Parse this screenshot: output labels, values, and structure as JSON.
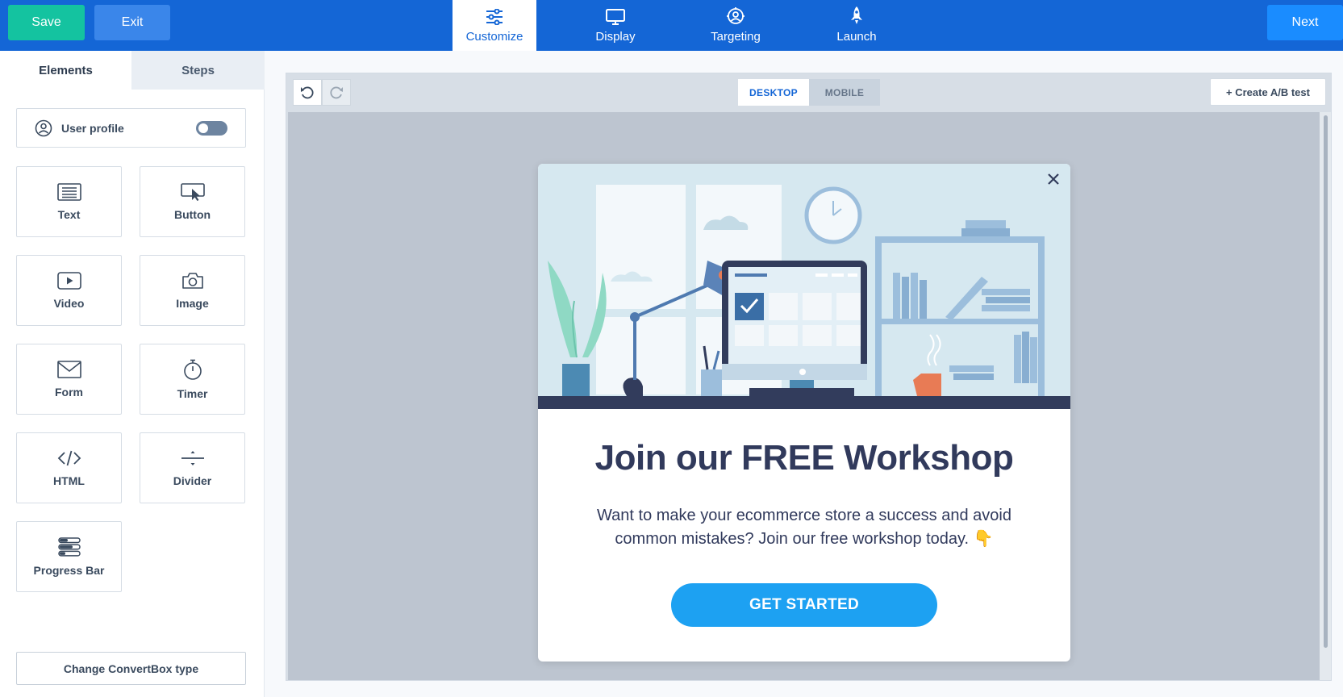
{
  "topbar": {
    "save_label": "Save",
    "exit_label": "Exit",
    "next_label": "Next",
    "tabs": [
      {
        "label": "Customize",
        "icon": "sliders-icon",
        "active": true
      },
      {
        "label": "Display",
        "icon": "monitor-icon",
        "active": false
      },
      {
        "label": "Targeting",
        "icon": "target-icon",
        "active": false
      },
      {
        "label": "Launch",
        "icon": "rocket-icon",
        "active": false
      }
    ]
  },
  "sidebar": {
    "tabs": [
      {
        "label": "Elements",
        "active": true
      },
      {
        "label": "Steps",
        "active": false
      }
    ],
    "user_profile": {
      "label": "User profile",
      "icon": "user-circle-icon",
      "enabled": false
    },
    "elements": [
      {
        "label": "Text",
        "icon": "text-icon"
      },
      {
        "label": "Button",
        "icon": "cursor-button-icon"
      },
      {
        "label": "Video",
        "icon": "video-icon"
      },
      {
        "label": "Image",
        "icon": "camera-icon"
      },
      {
        "label": "Form",
        "icon": "envelope-icon"
      },
      {
        "label": "Timer",
        "icon": "stopwatch-icon"
      },
      {
        "label": "HTML",
        "icon": "code-icon"
      },
      {
        "label": "Divider",
        "icon": "divider-icon"
      },
      {
        "label": "Progress Bar",
        "icon": "progress-bar-icon"
      }
    ],
    "change_type_label": "Change ConvertBox type"
  },
  "canvas": {
    "device_desktop": "DESKTOP",
    "device_mobile": "MOBILE",
    "active_device": "DESKTOP",
    "ab_test_label": "+ Create A/B test"
  },
  "popup": {
    "title": "Join our FREE Workshop",
    "text": "Want to make your ecommerce store a success and avoid common mistakes? Join our free workshop today. 👇",
    "cta_label": "GET STARTED"
  },
  "colors": {
    "topbar": "#1466d6",
    "save": "#14c3a0",
    "exit": "#3a86ea",
    "next": "#1a8cff",
    "cta": "#1da1f2",
    "title": "#313a5c"
  }
}
